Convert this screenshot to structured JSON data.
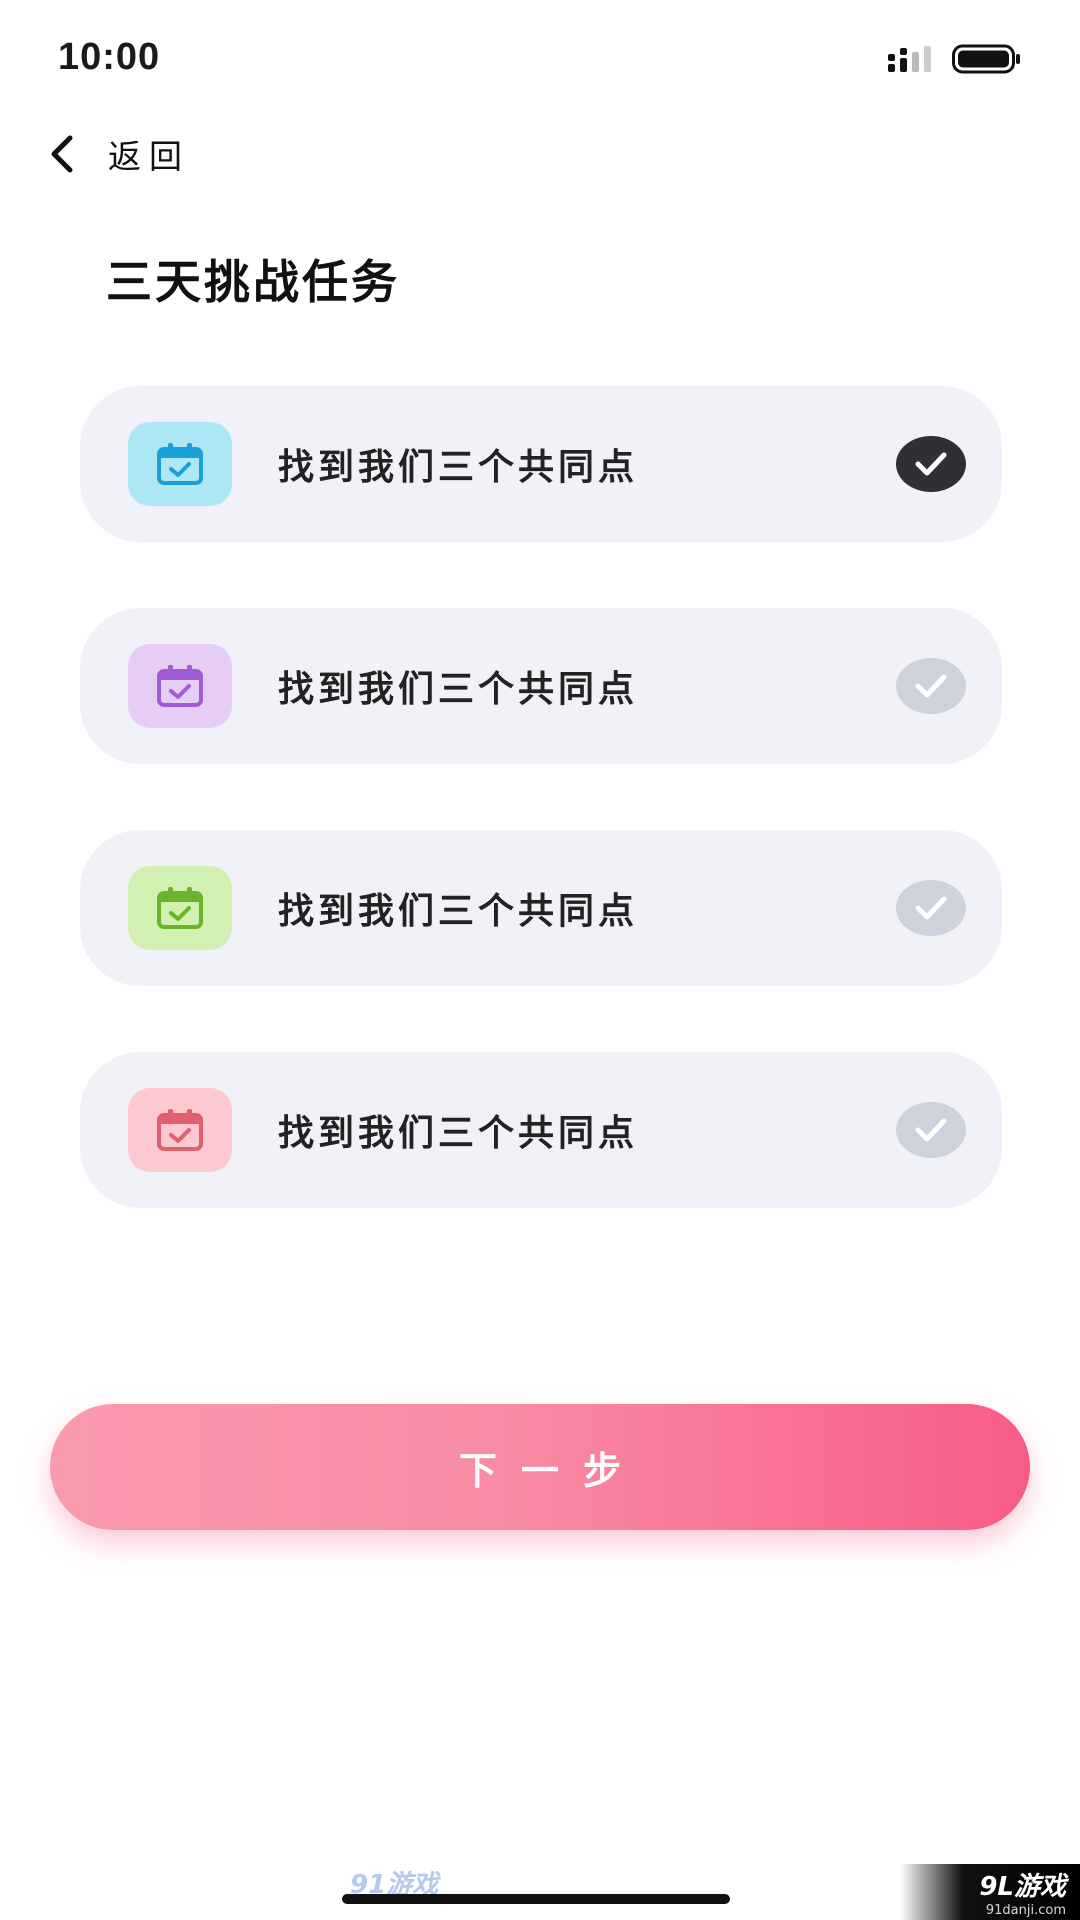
{
  "status_bar": {
    "time": "10:00",
    "signal_icon": "cellular-signal-icon",
    "battery_icon": "battery-full-icon"
  },
  "nav": {
    "back_label": "返回",
    "back_icon": "chevron-left-icon"
  },
  "title": "三天挑战任务",
  "tasks": [
    {
      "label": "找到我们三个共同点",
      "icon": "calendar-check-icon",
      "icon_bg": "#aee8f7",
      "icon_color": "#1aa0d8",
      "completed": true
    },
    {
      "label": "找到我们三个共同点",
      "icon": "calendar-check-icon",
      "icon_bg": "#e6cdf6",
      "icon_color": "#a35ad6",
      "completed": false
    },
    {
      "label": "找到我们三个共同点",
      "icon": "calendar-check-icon",
      "icon_bg": "#d3f0b3",
      "icon_color": "#6bb32a",
      "completed": false
    },
    {
      "label": "找到我们三个共同点",
      "icon": "calendar-check-icon",
      "icon_bg": "#fbc9cf",
      "icon_color": "#e0606f",
      "completed": false
    }
  ],
  "check_colors": {
    "done": "#2f3035",
    "pending": "#cfd2dc"
  },
  "next_button": {
    "label": "下一步"
  },
  "watermark": {
    "left": "91游戏",
    "right": "9L游戏",
    "right_sub": "91danji.com"
  },
  "colors": {
    "accent": "#f75c86",
    "card_bg": "#f1f2f7"
  }
}
